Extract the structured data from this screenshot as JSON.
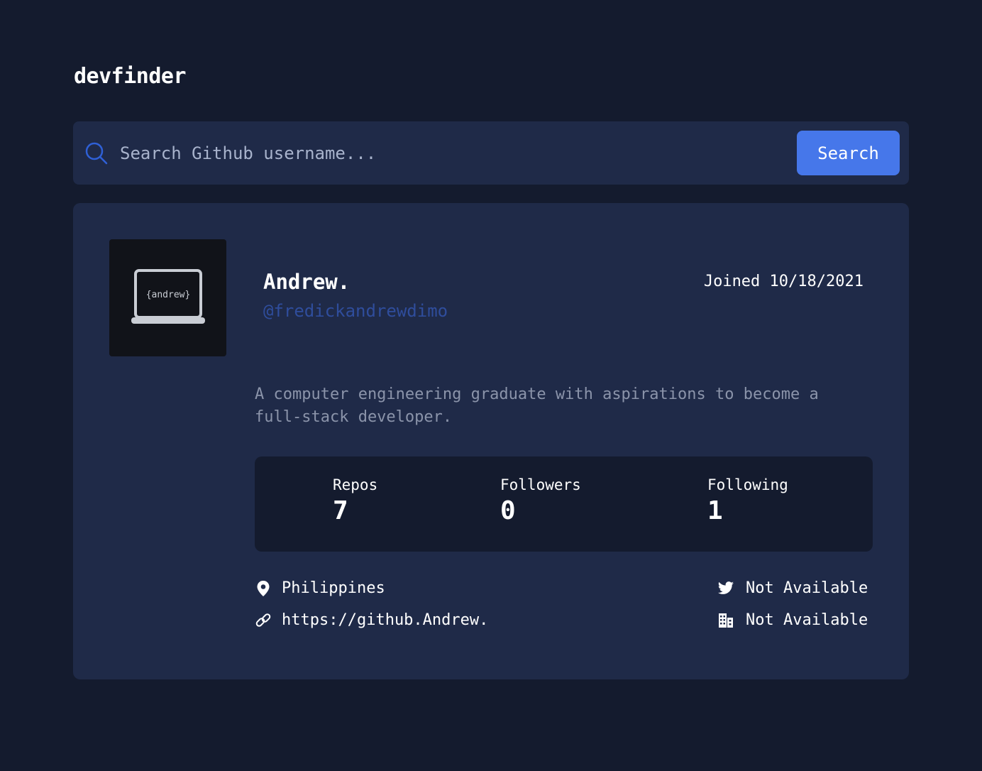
{
  "app": {
    "title": "devfinder"
  },
  "search": {
    "placeholder": "Search Github username...",
    "button_label": "Search"
  },
  "profile": {
    "avatar_text": "{andrew}",
    "name": "Andrew.",
    "login": "@fredickandrewdimo",
    "joined": "Joined 10/18/2021",
    "bio": "A computer engineering graduate with aspirations to become a full-stack developer.",
    "stats": {
      "repos_label": "Repos",
      "repos_value": "7",
      "followers_label": "Followers",
      "followers_value": "0",
      "following_label": "Following",
      "following_value": "1"
    },
    "links": {
      "location": "Philippines",
      "blog": "https://github.Andrew.",
      "twitter": "Not Available",
      "company": "Not Available"
    }
  },
  "colors": {
    "background": "#141b2e",
    "card": "#1f2a48",
    "accent": "#4677ea",
    "login": "#2f4d9c",
    "muted": "#8b94aa"
  },
  "icons": {
    "search": "search-icon",
    "location": "location-pin-icon",
    "link": "link-icon",
    "twitter": "twitter-icon",
    "company": "building-icon",
    "avatar": "laptop-icon"
  }
}
